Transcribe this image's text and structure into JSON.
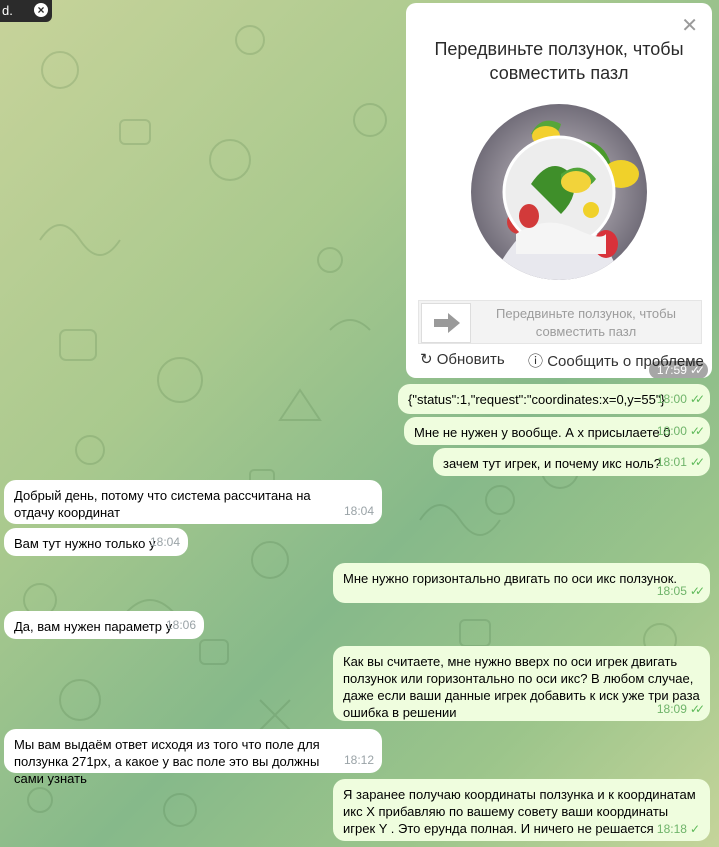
{
  "toast": {
    "text": "d.",
    "close_icon": "close-icon"
  },
  "captcha": {
    "title_line1": "Передвиньте ползунок, чтобы",
    "title_line2": "совместить пазл",
    "slider_hint_line1": "Передвиньте ползунок, чтобы",
    "slider_hint_line2": "совместить пазл",
    "refresh_label": "Обновить",
    "report_label": "Сообщить о проблеме",
    "time": "17:59"
  },
  "messages": [
    {
      "dir": "out",
      "text": "{\"status\":1,\"request\":\"coordinates:x=0,y=55\"}",
      "time": "18:00"
    },
    {
      "dir": "out",
      "text": "Мне не нужен у вообще. А х присылаете 0",
      "time": "18:00"
    },
    {
      "dir": "out",
      "text": "зачем тут игрек, и почему икс ноль?",
      "time": "18:01"
    },
    {
      "dir": "in",
      "text": "Добрый день, потому что система рассчитана на отдачу координат",
      "time": "18:04"
    },
    {
      "dir": "in",
      "text": "Вам тут нужно только у",
      "time": "18:04"
    },
    {
      "dir": "out",
      "text": "Мне нужно горизонтально двигать по оси икс ползунок.",
      "time": "18:05"
    },
    {
      "dir": "in",
      "text": "Да, вам нужен параметр у",
      "time": "18:06"
    },
    {
      "dir": "out",
      "text": "Как вы считаете, мне нужно вверх по оси игрек двигать ползунок или горизонтально по оси икс? В любом случае, даже если ваши данные игрек добавить к иск уже три раза ошибка в решении",
      "time": "18:09"
    },
    {
      "dir": "in",
      "text": "Мы вам выдаём ответ исходя из того что поле для ползунка 271px, а какое у вас поле это вы должны сами узнать",
      "time": "18:12"
    },
    {
      "dir": "out",
      "text": "Я заранее получаю координаты ползунка и к координатам икс Х прибавляю по вашему совету ваши координаты игрек Y . Это ерунда полная. И ничего не решается",
      "time": "18:18"
    }
  ]
}
